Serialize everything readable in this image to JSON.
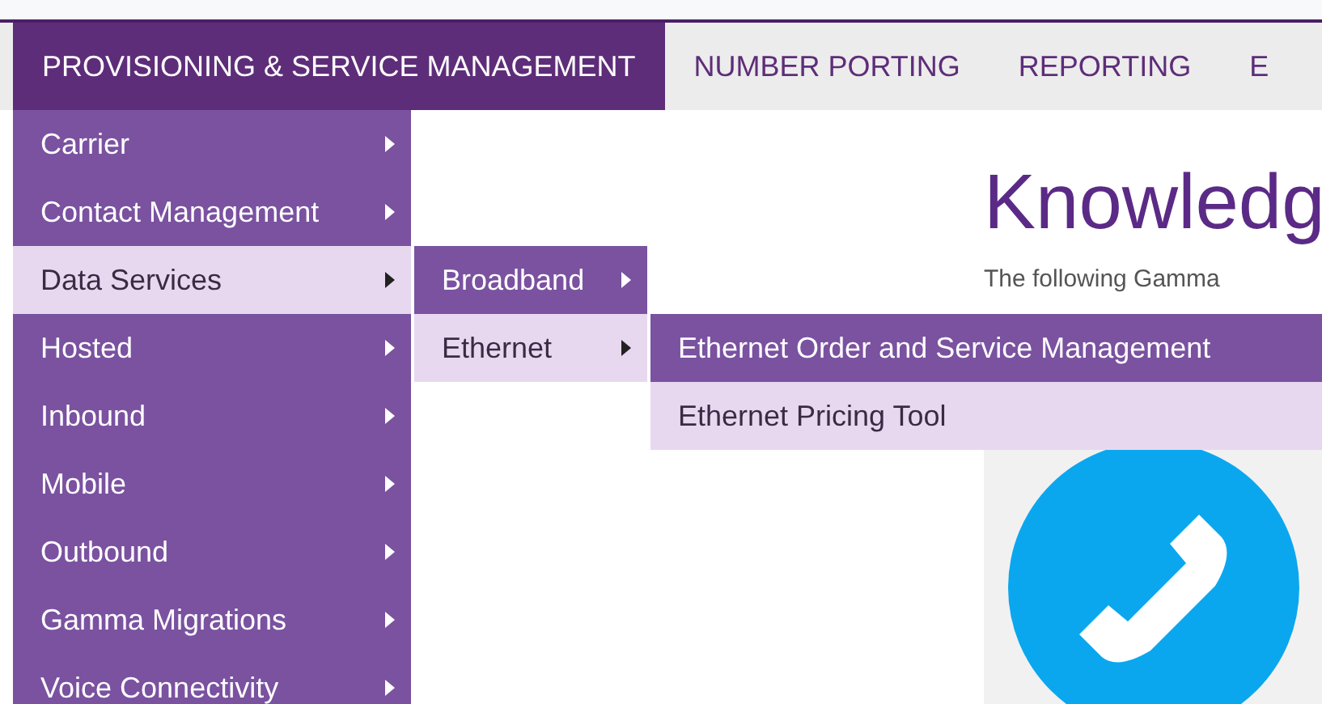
{
  "nav": {
    "tabs": [
      {
        "label": "PROVISIONING & SERVICE MANAGEMENT",
        "selected": true
      },
      {
        "label": "NUMBER PORTING",
        "selected": false
      },
      {
        "label": "REPORTING",
        "selected": false
      },
      {
        "label": "E",
        "selected": false
      }
    ]
  },
  "menu": {
    "items": [
      {
        "label": "Carrier",
        "selected": false,
        "submenu": true
      },
      {
        "label": "Contact Management",
        "selected": false,
        "submenu": true
      },
      {
        "label": "Data Services",
        "selected": true,
        "submenu": true,
        "children": [
          {
            "label": "Broadband",
            "selected": false,
            "submenu": true
          },
          {
            "label": "Ethernet",
            "selected": true,
            "submenu": true,
            "children": [
              {
                "label": "Ethernet Order and Service Management",
                "selected": false
              },
              {
                "label": "Ethernet Pricing Tool",
                "selected": true
              }
            ]
          }
        ]
      },
      {
        "label": "Hosted",
        "selected": false,
        "submenu": true
      },
      {
        "label": "Inbound",
        "selected": false,
        "submenu": true
      },
      {
        "label": "Mobile",
        "selected": false,
        "submenu": true
      },
      {
        "label": "Outbound",
        "selected": false,
        "submenu": true
      },
      {
        "label": "Gamma Migrations",
        "selected": false,
        "submenu": true
      },
      {
        "label": "Voice Connectivity",
        "selected": false,
        "submenu": true
      }
    ]
  },
  "content": {
    "heading": "Knowledg",
    "intro": "The following Gamma"
  }
}
